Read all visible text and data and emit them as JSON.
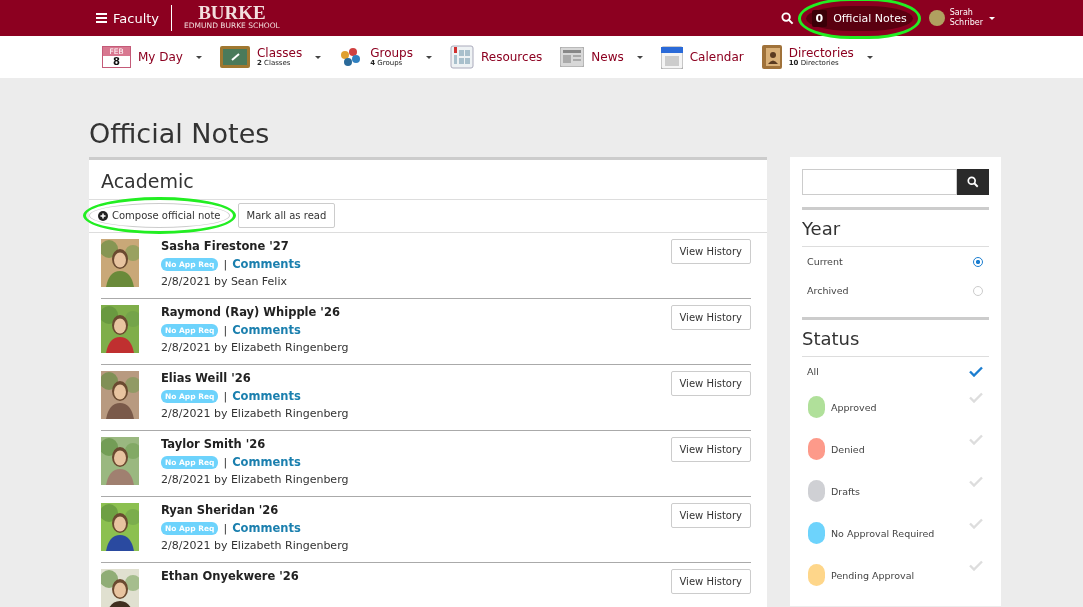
{
  "top_bar": {
    "menu_label": "Faculty",
    "logo": "BURKE",
    "logo_sub": "EDMUND BURKE SCHOOL",
    "notes_count": "0",
    "notes_label": "Official Notes",
    "notes_highlighted": true,
    "user_first": "Sarah",
    "user_last": "Schriber"
  },
  "nav": [
    {
      "kind": "date",
      "month": "FEB",
      "day": "8",
      "label": "My Day",
      "dropdown": true
    },
    {
      "kind": "board",
      "label": "Classes",
      "count": "2",
      "count_label": "Classes",
      "dropdown": true
    },
    {
      "kind": "groups",
      "label": "Groups",
      "count": "4",
      "count_label": "Groups",
      "dropdown": true
    },
    {
      "kind": "resources",
      "label": "Resources",
      "dropdown": false
    },
    {
      "kind": "news",
      "label": "News",
      "dropdown": true
    },
    {
      "kind": "calendar",
      "label": "Calendar",
      "dropdown": false
    },
    {
      "kind": "directory",
      "label": "Directories",
      "count": "10",
      "count_label": "Directories",
      "dropdown": true
    }
  ],
  "page_title": "Official Notes",
  "panel": {
    "title": "Academic",
    "compose_label": "Compose official note",
    "compose_highlighted": true,
    "mark_read_label": "Mark all as read",
    "notes": [
      {
        "name": "Sasha Firestone '27",
        "badge": "No App Req",
        "separator": "|",
        "link": "Comments",
        "meta": "2/8/2021 by Sean Felix",
        "button": "View History"
      },
      {
        "name": "Raymond (Ray) Whipple '26",
        "badge": "No App Req",
        "separator": "|",
        "link": "Comments",
        "meta": "2/8/2021 by Elizabeth Ringenberg",
        "button": "View History"
      },
      {
        "name": "Elias Weill '26",
        "badge": "No App Req",
        "separator": "|",
        "link": "Comments",
        "meta": "2/8/2021 by Elizabeth Ringenberg",
        "button": "View History"
      },
      {
        "name": "Taylor Smith '26",
        "badge": "No App Req",
        "separator": "|",
        "link": "Comments",
        "meta": "2/8/2021 by Elizabeth Ringenberg",
        "button": "View History"
      },
      {
        "name": "Ryan Sheridan '26",
        "badge": "No App Req",
        "separator": "|",
        "link": "Comments",
        "meta": "2/8/2021 by Elizabeth Ringenberg",
        "button": "View History"
      },
      {
        "name": "Ethan Onyekwere '26",
        "button": "View History"
      }
    ]
  },
  "sidebar": {
    "year_title": "Year",
    "years": [
      {
        "label": "Current",
        "selected": true
      },
      {
        "label": "Archived",
        "selected": false
      }
    ],
    "status_title": "Status",
    "all_label": "All",
    "all_checked": true,
    "statuses": [
      {
        "label": "Approved",
        "color": "#b0e09a",
        "checked": false
      },
      {
        "label": "Denied",
        "color": "#fd9a8a",
        "checked": false
      },
      {
        "label": "Drafts",
        "color": "#cfd0d4",
        "checked": false
      },
      {
        "label": "No Approval Required",
        "color": "#6dd3fc",
        "checked": false
      },
      {
        "label": "Pending Approval",
        "color": "#fed68a",
        "checked": false
      }
    ]
  }
}
